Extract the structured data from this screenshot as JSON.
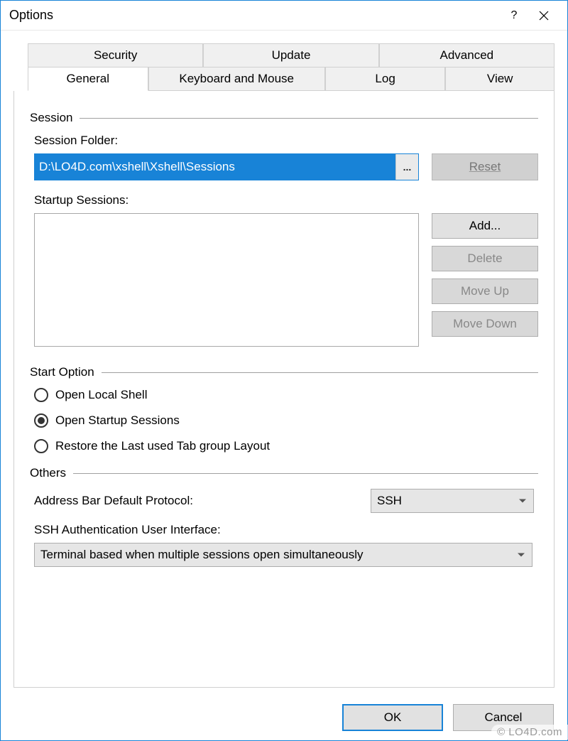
{
  "window": {
    "title": "Options"
  },
  "tabs": {
    "top": [
      "Security",
      "Update",
      "Advanced"
    ],
    "bottom": [
      "General",
      "Keyboard and Mouse",
      "Log",
      "View"
    ],
    "active": "General"
  },
  "session": {
    "heading": "Session",
    "folder_label": "Session Folder:",
    "folder_value": "D:\\LO4D.com\\xshell\\Xshell\\Sessions",
    "browse": "...",
    "reset": "Reset",
    "startup_label": "Startup Sessions:",
    "buttons": {
      "add": "Add...",
      "delete": "Delete",
      "move_up": "Move Up",
      "move_down": "Move Down"
    }
  },
  "start_option": {
    "heading": "Start Option",
    "options": [
      "Open Local Shell",
      "Open Startup Sessions",
      "Restore the Last used Tab group Layout"
    ],
    "selected_index": 1
  },
  "others": {
    "heading": "Others",
    "protocol_label": "Address Bar Default Protocol:",
    "protocol_value": "SSH",
    "ssh_auth_label": "SSH Authentication User Interface:",
    "ssh_auth_value": "Terminal based when multiple sessions open simultaneously"
  },
  "footer": {
    "ok": "OK",
    "cancel": "Cancel"
  },
  "watermark": "© LO4D.com"
}
